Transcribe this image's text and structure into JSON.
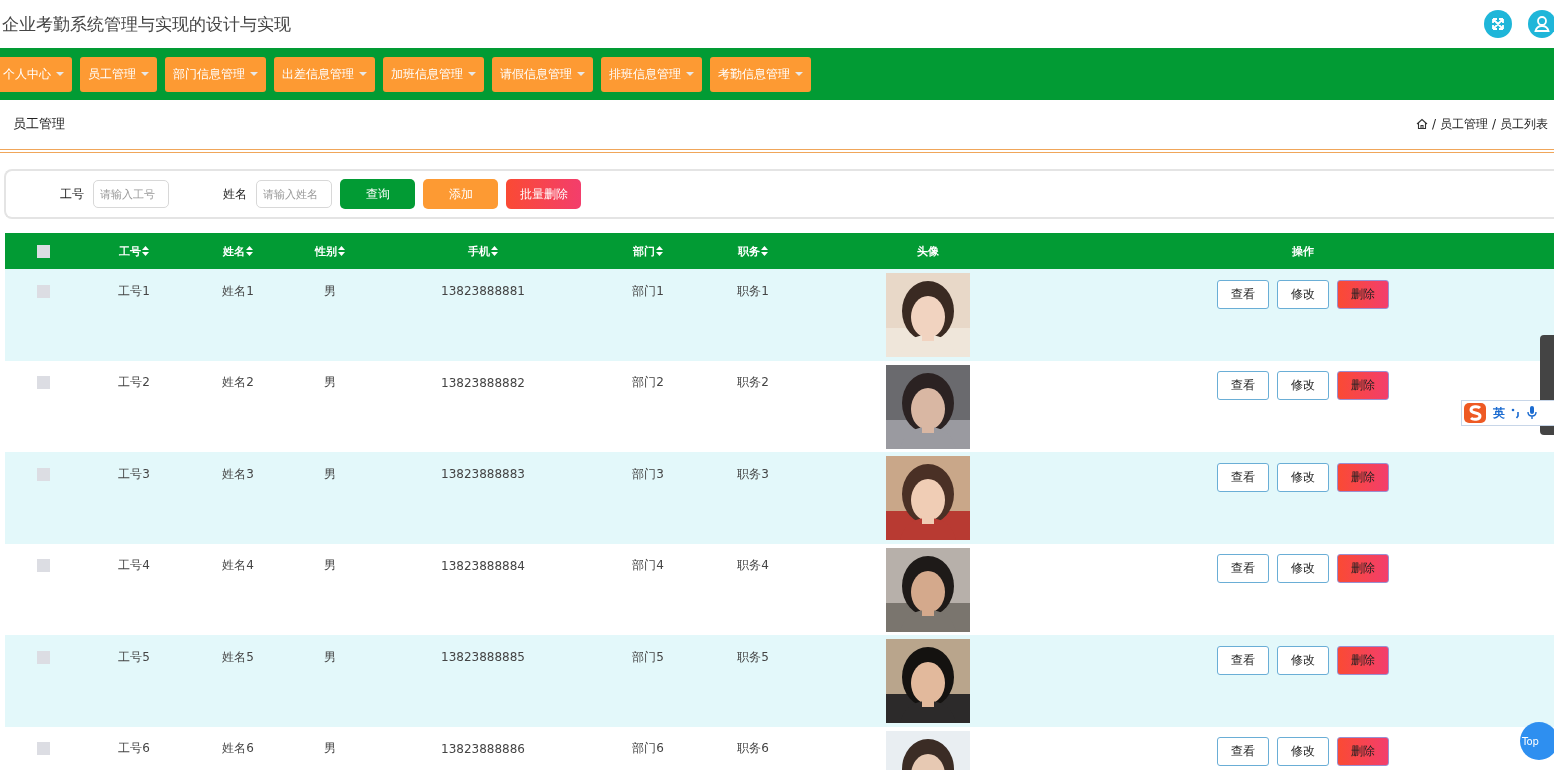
{
  "header": {
    "title": "企业考勤系统管理与实现的设计与实现"
  },
  "nav": [
    {
      "label": "个人中心"
    },
    {
      "label": "员工管理"
    },
    {
      "label": "部门信息管理"
    },
    {
      "label": "出差信息管理"
    },
    {
      "label": "加班信息管理"
    },
    {
      "label": "请假信息管理"
    },
    {
      "label": "排班信息管理"
    },
    {
      "label": "考勤信息管理"
    }
  ],
  "page_title": "员工管理",
  "breadcrumb": {
    "separator": "/",
    "items": [
      "员工管理",
      "员工列表"
    ]
  },
  "search": {
    "fields": [
      {
        "label": "工号",
        "placeholder": "请输入工号"
      },
      {
        "label": "姓名",
        "placeholder": "请输入姓名"
      }
    ],
    "buttons": [
      {
        "label": "查询",
        "kind": "query"
      },
      {
        "label": "添加",
        "kind": "add"
      },
      {
        "label": "批量删除",
        "kind": "delete"
      }
    ]
  },
  "table": {
    "all_checked": false,
    "columns": [
      {
        "label": "工号",
        "sortable": true
      },
      {
        "label": "姓名",
        "sortable": true
      },
      {
        "label": "性别",
        "sortable": true
      },
      {
        "label": "手机",
        "sortable": true
      },
      {
        "label": "部门",
        "sortable": true
      },
      {
        "label": "职务",
        "sortable": true
      },
      {
        "label": "头像",
        "sortable": false
      },
      {
        "label": "操作",
        "sortable": false
      }
    ],
    "rows": [
      {
        "checked": false,
        "cells": [
          "工号1",
          "姓名1",
          "男",
          "13823888881",
          "部门1",
          "职务1"
        ],
        "actions": [
          "查看",
          "修改",
          "删除"
        ]
      },
      {
        "checked": false,
        "cells": [
          "工号2",
          "姓名2",
          "男",
          "13823888882",
          "部门2",
          "职务2"
        ],
        "actions": [
          "查看",
          "修改",
          "删除"
        ]
      },
      {
        "checked": false,
        "cells": [
          "工号3",
          "姓名3",
          "男",
          "13823888883",
          "部门3",
          "职务3"
        ],
        "actions": [
          "查看",
          "修改",
          "删除"
        ]
      },
      {
        "checked": false,
        "cells": [
          "工号4",
          "姓名4",
          "男",
          "13823888884",
          "部门4",
          "职务4"
        ],
        "actions": [
          "查看",
          "修改",
          "删除"
        ]
      },
      {
        "checked": false,
        "cells": [
          "工号5",
          "姓名5",
          "男",
          "13823888885",
          "部门5",
          "职务5"
        ],
        "actions": [
          "查看",
          "修改",
          "删除"
        ]
      },
      {
        "checked": false,
        "cells": [
          "工号6",
          "姓名6",
          "男",
          "13823888886",
          "部门6",
          "职务6"
        ],
        "actions": [
          "查看",
          "修改",
          "删除"
        ]
      }
    ]
  },
  "ime_toolbar": {
    "mode": "英"
  },
  "back_to_top": "Top"
}
